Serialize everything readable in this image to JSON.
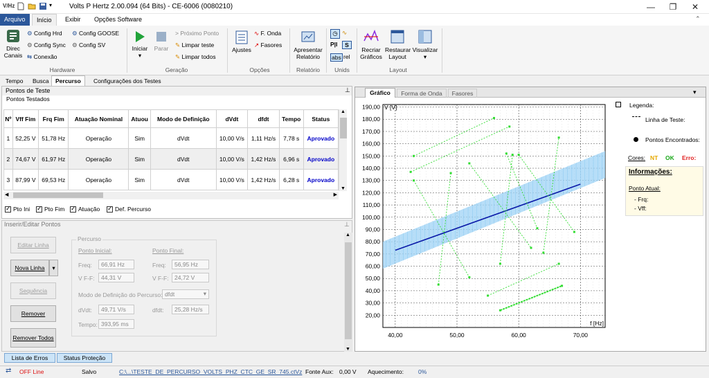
{
  "window": {
    "title": "Volts P Hertz 2.00.094 (64 Bits) - CE-6006 (0080210)",
    "logo": "V/Hz"
  },
  "menu": [
    "Arquivo",
    "Início",
    "Exibir",
    "Opções Software"
  ],
  "ribbon": {
    "hardware": {
      "direc": "Direc\nCanais",
      "config_hrd": "Config Hrd",
      "config_sync": "Config Sync",
      "conexao": "Conexão",
      "config_goose": "Config GOOSE",
      "config_sv": "Config SV",
      "label": "Hardware"
    },
    "geracao": {
      "iniciar": "Iniciar",
      "parar": "Parar",
      "proximo": "Próximo Ponto",
      "limpar_teste": "Limpar teste",
      "limpar_todos": "Limpar todos",
      "label": "Geração"
    },
    "opcoes": {
      "ajustes": "Ajustes",
      "fonda": "F. Onda",
      "fasores": "Fasores",
      "label": "Opções"
    },
    "relatorio": {
      "apresentar": "Apresentar\nRelatório",
      "label": "Relatório"
    },
    "unidades": {
      "label": "Unids",
      "abs": "abs",
      "rel": "rel"
    },
    "layout": {
      "recriar": "Recriar\nGráficos",
      "restaurar": "Restaurar\nLayout",
      "visualizar": "Visualizar",
      "label": "Layout"
    }
  },
  "tabs": [
    "Tempo",
    "Busca",
    "Percurso",
    "Configurações dos Testes"
  ],
  "pontos": {
    "title": "Pontos de Teste",
    "subtitle": "Pontos Testados",
    "columns": [
      "Nº",
      "Vff Fim",
      "Frq Fim",
      "Atuação Nominal",
      "Atuou",
      "Modo de Definição",
      "dVdt",
      "dfdt",
      "Tempo",
      "Status"
    ],
    "rows": [
      [
        "1",
        "52,25 V",
        "51,78 Hz",
        "Operação",
        "Sim",
        "dVdt",
        "10,00 V/s",
        "1,11 Hz/s",
        "7,78 s",
        "Aprovado"
      ],
      [
        "2",
        "74,67 V",
        "61,97 Hz",
        "Operação",
        "Sim",
        "dVdt",
        "10,00 V/s",
        "1,42 Hz/s",
        "6,96 s",
        "Aprovado"
      ],
      [
        "3",
        "87,99 V",
        "69,53 Hz",
        "Operação",
        "Sim",
        "dVdt",
        "10,00 V/s",
        "1,42 Hz/s",
        "6,28 s",
        "Aprovado"
      ]
    ],
    "checks": [
      "Pto Ini",
      "Pto Fim",
      "Atuação",
      "Def. Percurso"
    ]
  },
  "inserir": {
    "title": "Inserir/Editar Pontos",
    "editar": "Editar Linha",
    "nova": "Nova Linha",
    "sequencia": "Sequência",
    "remover": "Remover",
    "remover_todos": "Remover Todos",
    "percurso": "Percurso",
    "ponto_inicial": "Ponto Inicial:",
    "ponto_final": "Ponto Final:",
    "freq": "Freq:",
    "vff": "V F-F:",
    "freq_ini": "66,91 Hz",
    "vff_ini": "44,31 V",
    "freq_fim": "56,95 Hz",
    "vff_fim": "24,72 V",
    "modo_label": "Modo de Definição do Percurso:",
    "modo_val": "dfdt",
    "dvdt_label": "dVdt:",
    "dvdt_val": "49,71 V/s",
    "dfdt_label": "dfdt:",
    "dfdt_val": "25,28 Hz/s",
    "tempo_label": "Tempo:",
    "tempo_val": "393,95 ms"
  },
  "bottom_tabs": [
    "Lista de Erros",
    "Status Proteção"
  ],
  "graph_tabs": [
    "Gráfico",
    "Forma de Onda",
    "Fasores"
  ],
  "legend": {
    "title": "Legenda:",
    "linha": "Linha de Teste:",
    "pontos": "Pontos Encontrados:",
    "cores": "Cores:",
    "nt": "NT",
    "ok": "OK",
    "erro": "Erro:",
    "info": "Informações:",
    "ponto_atual": "Ponto Atual:",
    "frq": "- Frq:",
    "vff": "- Vff:"
  },
  "status": {
    "offline": "OFF Line",
    "salvo": "Salvo",
    "path": "C:\\...\\TESTE_DE_PERCURSO_VOLTS_PHZ_CTC_GE_SR_745.ctVz",
    "fonte": "Fonte Aux:",
    "fonte_val": "0,00 V",
    "aquec": "Aquecimento:",
    "aquec_val": "0%"
  },
  "chart_data": {
    "type": "line",
    "xlabel": "f [Hz]",
    "ylabel": "V [V]",
    "xlim": [
      38,
      74
    ],
    "ylim": [
      10,
      192
    ],
    "xticks": [
      "40,00",
      "50,00",
      "60,00",
      "70,00"
    ],
    "yticks": [
      "20,00",
      "30,00",
      "40,00",
      "50,00",
      "60,00",
      "70,00",
      "80,00",
      "90,00",
      "100,00",
      "110,00",
      "120,00",
      "130,00",
      "140,00",
      "150,00",
      "160,00",
      "170,00",
      "180,00",
      "190,00"
    ],
    "band": {
      "upper": [
        [
          38,
          80
        ],
        [
          74,
          154
        ]
      ],
      "lower": [
        [
          38,
          58
        ],
        [
          74,
          132
        ]
      ]
    },
    "characteristic": [
      [
        40,
        73
      ],
      [
        70,
        127
      ]
    ],
    "test_paths": [
      [
        [
          43,
          150
        ],
        [
          56,
          181
        ]
      ],
      [
        [
          42.5,
          137
        ],
        [
          58.5,
          174
        ]
      ],
      [
        [
          43,
          130
        ],
        [
          52,
          51
        ]
      ],
      [
        [
          47,
          45
        ],
        [
          49,
          136
        ]
      ],
      [
        [
          52,
          144
        ],
        [
          62,
          75
        ]
      ],
      [
        [
          57,
          62
        ],
        [
          59,
          151
        ]
      ],
      [
        [
          58,
          152
        ],
        [
          63,
          91
        ]
      ],
      [
        [
          60,
          151
        ],
        [
          69,
          88
        ]
      ],
      [
        [
          64,
          71
        ],
        [
          66.5,
          165
        ]
      ],
      [
        [
          55,
          36
        ],
        [
          66.5,
          62
        ]
      ],
      [
        [
          57,
          24
        ],
        [
          67,
          44
        ]
      ]
    ],
    "colors": {
      "band": "#9fd3f5",
      "characteristic": "#0a1aa8",
      "paths": "#33dd33",
      "nt": "#e6a800",
      "ok": "#1aa81a",
      "erro": "#e02020"
    }
  }
}
